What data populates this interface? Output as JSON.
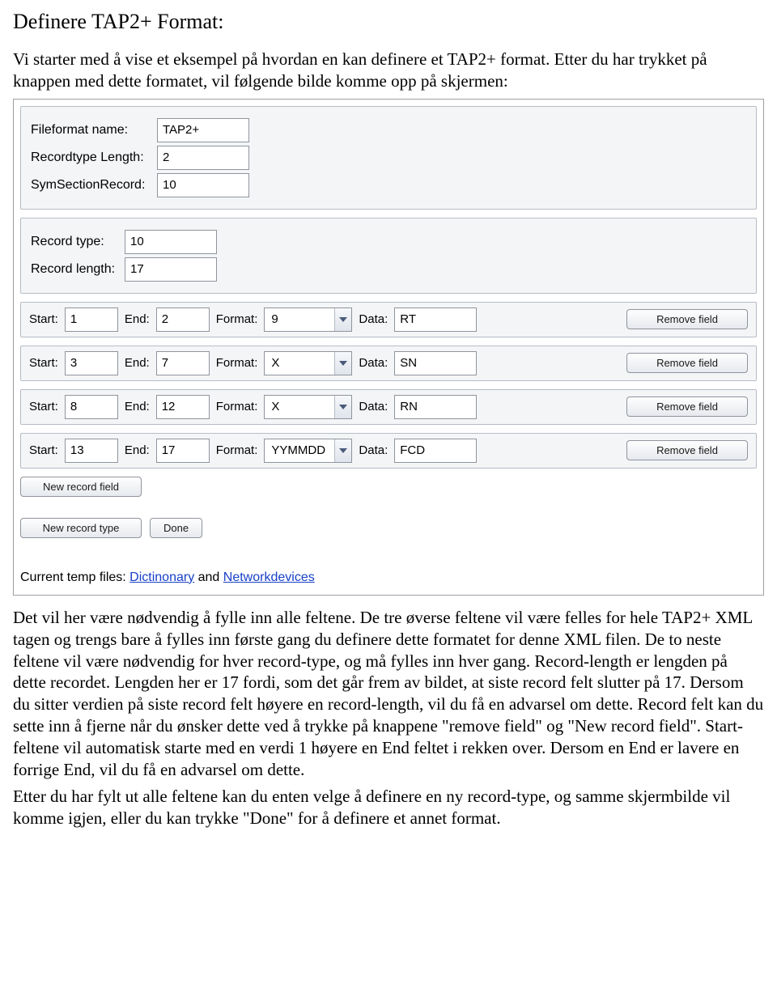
{
  "title": "Definere TAP2+ Format:",
  "intro": "Vi starter med å vise et eksempel på hvordan en kan definere et TAP2+ format. Etter du har trykket på knappen med dette formatet, vil følgende bilde komme opp på skjermen:",
  "form": {
    "fileformat_label": "Fileformat name:",
    "fileformat_value": "TAP2+",
    "recordtype_len_label": "Recordtype Length:",
    "recordtype_len_value": "2",
    "symsection_label": "SymSectionRecord:",
    "symsection_value": "10",
    "recordtype_label": "Record type:",
    "recordtype_value": "10",
    "recordlength_label": "Record length:",
    "recordlength_value": "17",
    "start_label": "Start:",
    "end_label": "End:",
    "format_label": "Format:",
    "data_label": "Data:",
    "remove_label": "Remove field",
    "rows": [
      {
        "start": "1",
        "end": "2",
        "format": "9",
        "data": "RT"
      },
      {
        "start": "3",
        "end": "7",
        "format": "X",
        "data": "SN"
      },
      {
        "start": "8",
        "end": "12",
        "format": "X",
        "data": "RN"
      },
      {
        "start": "13",
        "end": "17",
        "format": "YYMMDD",
        "data": "FCD"
      }
    ],
    "new_record_field": "New record field",
    "new_record_type": "New record type",
    "done": "Done",
    "temp_files_prefix": "Current temp files: ",
    "temp_link1": "Dictinonary",
    "temp_and": " and ",
    "temp_link2": "Networkdevices"
  },
  "body": "Det vil her være nødvendig å fylle inn alle feltene. De tre øverse feltene vil være felles for hele TAP2+ XML tagen og trengs bare å fylles inn første gang du definere dette formatet for denne XML filen. De to neste feltene vil være nødvendig for hver record-type, og må fylles inn hver gang. Record-length er lengden på dette recordet. Lengden her er 17 fordi, som det går frem av bildet, at siste record felt slutter på 17. Dersom du sitter verdien på siste record felt høyere en record-length, vil du få en advarsel om dette. Record felt kan du sette inn å fjerne når du ønsker dette ved å trykke på knappene \"remove field\" og \"New record field\". Start-feltene vil automatisk starte med en verdi 1 høyere en End feltet i rekken over. Dersom en End er lavere en forrige End, vil du få en advarsel om dette.",
  "body2": "Etter du har fylt ut alle feltene kan du enten velge å definere en ny record-type, og samme skjermbilde vil komme igjen, eller du kan trykke \"Done\" for å definere et annet format."
}
